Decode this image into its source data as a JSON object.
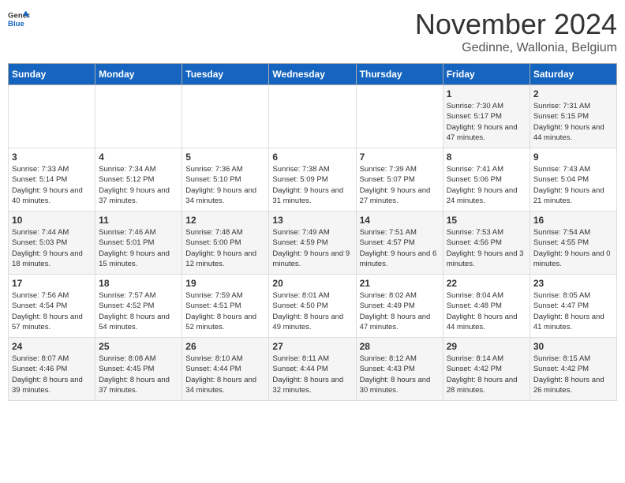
{
  "logo": {
    "general": "General",
    "blue": "Blue"
  },
  "title": "November 2024",
  "subtitle": "Gedinne, Wallonia, Belgium",
  "days_of_week": [
    "Sunday",
    "Monday",
    "Tuesday",
    "Wednesday",
    "Thursday",
    "Friday",
    "Saturday"
  ],
  "weeks": [
    [
      {
        "day": "",
        "info": ""
      },
      {
        "day": "",
        "info": ""
      },
      {
        "day": "",
        "info": ""
      },
      {
        "day": "",
        "info": ""
      },
      {
        "day": "",
        "info": ""
      },
      {
        "day": "1",
        "info": "Sunrise: 7:30 AM\nSunset: 5:17 PM\nDaylight: 9 hours and 47 minutes."
      },
      {
        "day": "2",
        "info": "Sunrise: 7:31 AM\nSunset: 5:15 PM\nDaylight: 9 hours and 44 minutes."
      }
    ],
    [
      {
        "day": "3",
        "info": "Sunrise: 7:33 AM\nSunset: 5:14 PM\nDaylight: 9 hours and 40 minutes."
      },
      {
        "day": "4",
        "info": "Sunrise: 7:34 AM\nSunset: 5:12 PM\nDaylight: 9 hours and 37 minutes."
      },
      {
        "day": "5",
        "info": "Sunrise: 7:36 AM\nSunset: 5:10 PM\nDaylight: 9 hours and 34 minutes."
      },
      {
        "day": "6",
        "info": "Sunrise: 7:38 AM\nSunset: 5:09 PM\nDaylight: 9 hours and 31 minutes."
      },
      {
        "day": "7",
        "info": "Sunrise: 7:39 AM\nSunset: 5:07 PM\nDaylight: 9 hours and 27 minutes."
      },
      {
        "day": "8",
        "info": "Sunrise: 7:41 AM\nSunset: 5:06 PM\nDaylight: 9 hours and 24 minutes."
      },
      {
        "day": "9",
        "info": "Sunrise: 7:43 AM\nSunset: 5:04 PM\nDaylight: 9 hours and 21 minutes."
      }
    ],
    [
      {
        "day": "10",
        "info": "Sunrise: 7:44 AM\nSunset: 5:03 PM\nDaylight: 9 hours and 18 minutes."
      },
      {
        "day": "11",
        "info": "Sunrise: 7:46 AM\nSunset: 5:01 PM\nDaylight: 9 hours and 15 minutes."
      },
      {
        "day": "12",
        "info": "Sunrise: 7:48 AM\nSunset: 5:00 PM\nDaylight: 9 hours and 12 minutes."
      },
      {
        "day": "13",
        "info": "Sunrise: 7:49 AM\nSunset: 4:59 PM\nDaylight: 9 hours and 9 minutes."
      },
      {
        "day": "14",
        "info": "Sunrise: 7:51 AM\nSunset: 4:57 PM\nDaylight: 9 hours and 6 minutes."
      },
      {
        "day": "15",
        "info": "Sunrise: 7:53 AM\nSunset: 4:56 PM\nDaylight: 9 hours and 3 minutes."
      },
      {
        "day": "16",
        "info": "Sunrise: 7:54 AM\nSunset: 4:55 PM\nDaylight: 9 hours and 0 minutes."
      }
    ],
    [
      {
        "day": "17",
        "info": "Sunrise: 7:56 AM\nSunset: 4:54 PM\nDaylight: 8 hours and 57 minutes."
      },
      {
        "day": "18",
        "info": "Sunrise: 7:57 AM\nSunset: 4:52 PM\nDaylight: 8 hours and 54 minutes."
      },
      {
        "day": "19",
        "info": "Sunrise: 7:59 AM\nSunset: 4:51 PM\nDaylight: 8 hours and 52 minutes."
      },
      {
        "day": "20",
        "info": "Sunrise: 8:01 AM\nSunset: 4:50 PM\nDaylight: 8 hours and 49 minutes."
      },
      {
        "day": "21",
        "info": "Sunrise: 8:02 AM\nSunset: 4:49 PM\nDaylight: 8 hours and 47 minutes."
      },
      {
        "day": "22",
        "info": "Sunrise: 8:04 AM\nSunset: 4:48 PM\nDaylight: 8 hours and 44 minutes."
      },
      {
        "day": "23",
        "info": "Sunrise: 8:05 AM\nSunset: 4:47 PM\nDaylight: 8 hours and 41 minutes."
      }
    ],
    [
      {
        "day": "24",
        "info": "Sunrise: 8:07 AM\nSunset: 4:46 PM\nDaylight: 8 hours and 39 minutes."
      },
      {
        "day": "25",
        "info": "Sunrise: 8:08 AM\nSunset: 4:45 PM\nDaylight: 8 hours and 37 minutes."
      },
      {
        "day": "26",
        "info": "Sunrise: 8:10 AM\nSunset: 4:44 PM\nDaylight: 8 hours and 34 minutes."
      },
      {
        "day": "27",
        "info": "Sunrise: 8:11 AM\nSunset: 4:44 PM\nDaylight: 8 hours and 32 minutes."
      },
      {
        "day": "28",
        "info": "Sunrise: 8:12 AM\nSunset: 4:43 PM\nDaylight: 8 hours and 30 minutes."
      },
      {
        "day": "29",
        "info": "Sunrise: 8:14 AM\nSunset: 4:42 PM\nDaylight: 8 hours and 28 minutes."
      },
      {
        "day": "30",
        "info": "Sunrise: 8:15 AM\nSunset: 4:42 PM\nDaylight: 8 hours and 26 minutes."
      }
    ]
  ]
}
